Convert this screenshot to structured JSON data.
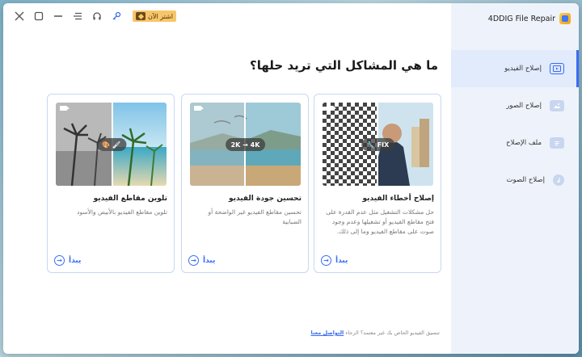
{
  "app": {
    "title": "4DDIG File Repair"
  },
  "titlebar": {
    "buy_label": "اشتر الآن"
  },
  "main": {
    "heading": "ما هي المشاكل التي تريد حلها؟",
    "cards": [
      {
        "title": "إصلاح أخطاء الفيديو",
        "description": "حل مشكلات التشغيل مثل عدم القدرة على فتح مقاطع الفيديو أو تشغيلها وعدم وجود صوت على مقاطع الفيديو وما إلى ذلك.",
        "badge": "FIX",
        "start_label": "يبدأ"
      },
      {
        "title": "تحسين جودة الفيديو",
        "description": "تحسين مقاطع الفيديو غير الواضحة أو الضبابية",
        "badge": "2K → 4K",
        "start_label": "يبدأ"
      },
      {
        "title": "تلوين مقاطع الفيديو",
        "description": "تلوين مقاطع الفيديو بالأبيض والأسود",
        "badge": "",
        "start_label": "يبدأ"
      }
    ],
    "footer_text": "تنسيق الفيديو الخاص بك غير معتمد؟ الرجاء",
    "footer_link": "التواصل معنا"
  },
  "sidebar": {
    "items": [
      {
        "label": "إصلاح الفيديو",
        "icon": "video-icon",
        "active": true
      },
      {
        "label": "إصلاح الصور",
        "icon": "image-icon",
        "active": false
      },
      {
        "label": "ملف الإصلاح",
        "icon": "file-icon",
        "active": false
      },
      {
        "label": "إصلاح الصوت",
        "icon": "audio-icon",
        "active": false
      }
    ]
  },
  "colors": {
    "accent": "#3a6cf4",
    "buy": "#f7c56a",
    "sidebar_bg": "#eef3fb"
  }
}
